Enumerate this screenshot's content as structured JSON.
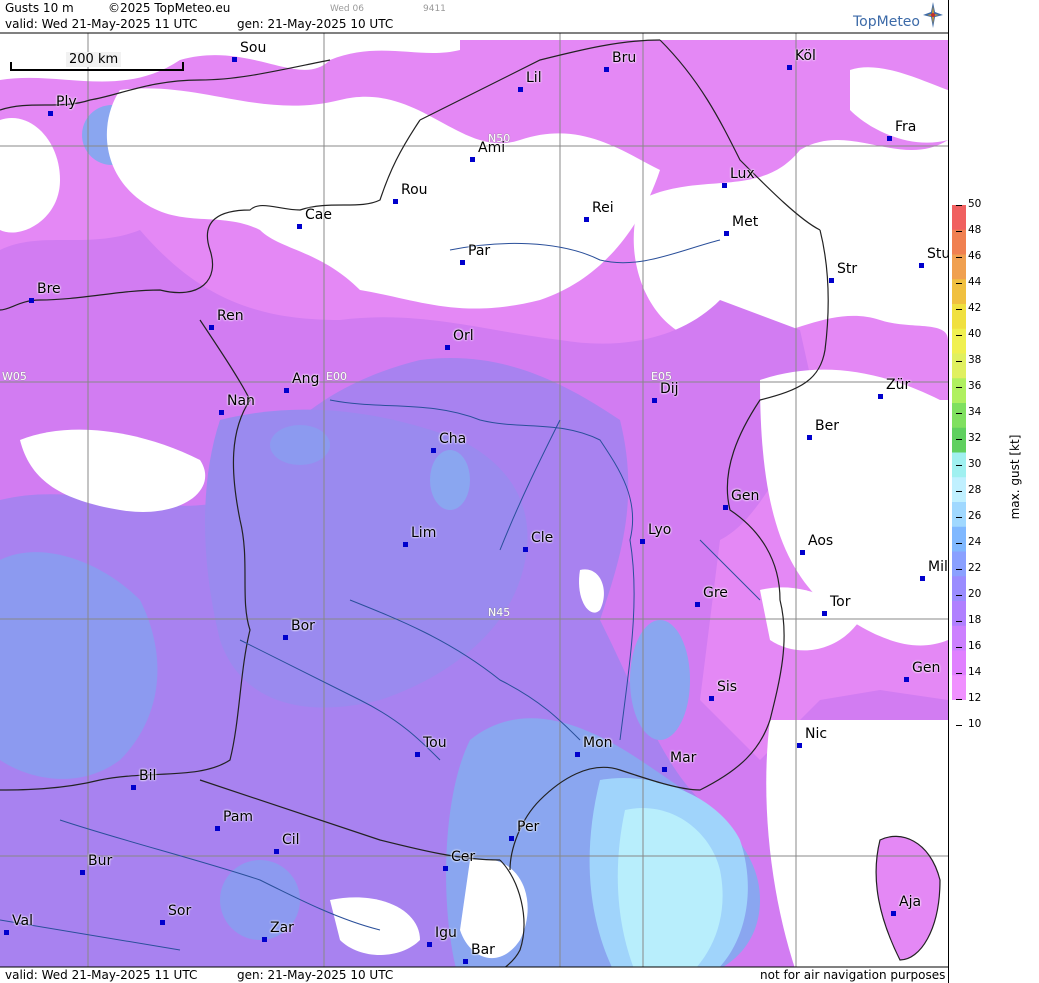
{
  "header": {
    "title": "Gusts 10 m",
    "copyright": "©2025 TopMeteo.eu",
    "valid": "valid:  Wed  21-May-2025  11 UTC",
    "gen": "gen: 21-May-2025 10 UTC",
    "day_code": "Wed 06",
    "code": "9411"
  },
  "footer": {
    "valid": "valid:  Wed  21-May-2025  11 UTC",
    "gen": "gen: 21-May-2025 10 UTC",
    "disclaimer": "not for air navigation purposes"
  },
  "logo": {
    "text": "TopMeteo",
    "icon": "compass-star-icon"
  },
  "scale": {
    "label": "200 km"
  },
  "grid_labels": [
    "N50",
    "N45",
    "W05",
    "E00",
    "E05"
  ],
  "legend": {
    "title": "max. gust  [kt]",
    "ticks": [
      "50",
      "48",
      "46",
      "44",
      "42",
      "40",
      "38",
      "36",
      "34",
      "32",
      "30",
      "28",
      "26",
      "24",
      "22",
      "20",
      "18",
      "16",
      "14",
      "12",
      "10"
    ],
    "colors": [
      "#f06060",
      "#f08050",
      "#f0a050",
      "#f0c040",
      "#f0e040",
      "#f0f050",
      "#e0f060",
      "#b0f060",
      "#80e060",
      "#60d060",
      "#a0f0f0",
      "#c0f0ff",
      "#a0d8ff",
      "#80b8ff",
      "#8aa0ff",
      "#9a8cff",
      "#b080ff",
      "#cc80ff",
      "#e080ff",
      "#f090ff"
    ]
  },
  "cities": [
    {
      "name": "Sou"
    },
    {
      "name": "Ply"
    },
    {
      "name": "Lil"
    },
    {
      "name": "Bru"
    },
    {
      "name": "Köl"
    },
    {
      "name": "Fra"
    },
    {
      "name": "Ami"
    },
    {
      "name": "Rou"
    },
    {
      "name": "Cae"
    },
    {
      "name": "Lux"
    },
    {
      "name": "Rei"
    },
    {
      "name": "Met"
    },
    {
      "name": "Par"
    },
    {
      "name": "Bre"
    },
    {
      "name": "Str"
    },
    {
      "name": "Stu"
    },
    {
      "name": "Ren"
    },
    {
      "name": "Orl"
    },
    {
      "name": "Ang"
    },
    {
      "name": "Dij"
    },
    {
      "name": "Zür"
    },
    {
      "name": "Nan"
    },
    {
      "name": "Cha"
    },
    {
      "name": "Ber"
    },
    {
      "name": "Gen"
    },
    {
      "name": "Lim"
    },
    {
      "name": "Cle"
    },
    {
      "name": "Lyo"
    },
    {
      "name": "Aos"
    },
    {
      "name": "Mil"
    },
    {
      "name": "Gre"
    },
    {
      "name": "Tor"
    },
    {
      "name": "Bor"
    },
    {
      "name": "Gen"
    },
    {
      "name": "Sis"
    },
    {
      "name": "Nic"
    },
    {
      "name": "Tou"
    },
    {
      "name": "Mon"
    },
    {
      "name": "Mar"
    },
    {
      "name": "Bil"
    },
    {
      "name": "Pam"
    },
    {
      "name": "Cil"
    },
    {
      "name": "Per"
    },
    {
      "name": "Cer"
    },
    {
      "name": "Bur"
    },
    {
      "name": "Sor"
    },
    {
      "name": "Val"
    },
    {
      "name": "Zar"
    },
    {
      "name": "Igu"
    },
    {
      "name": "Bar"
    },
    {
      "name": "Aja"
    }
  ]
}
